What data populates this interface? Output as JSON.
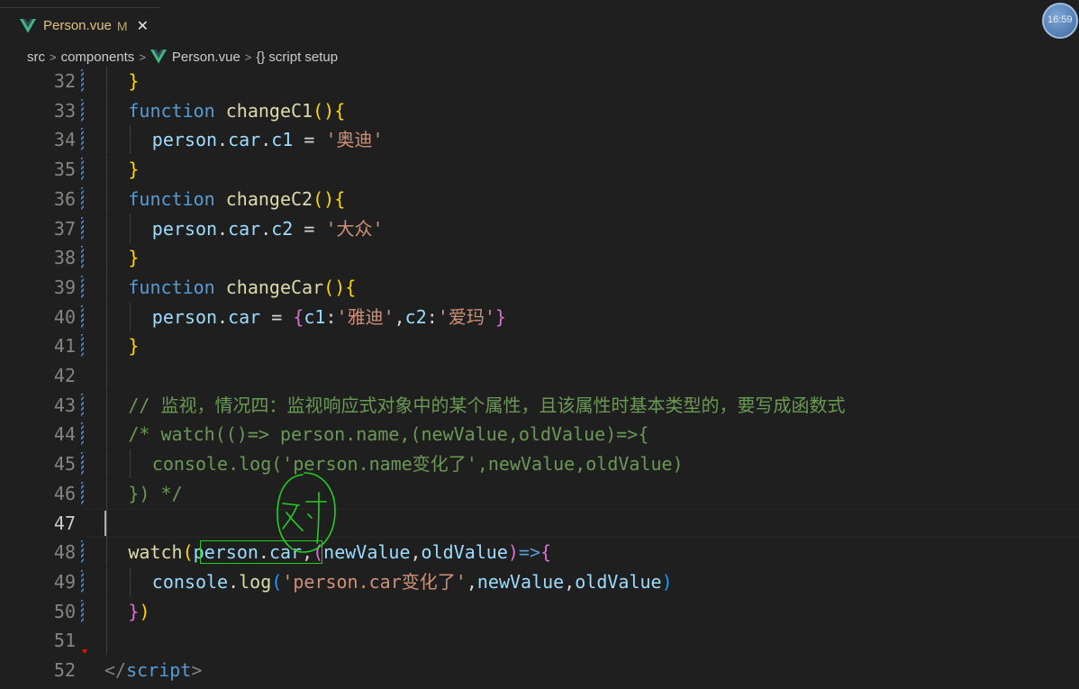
{
  "tab": {
    "label": "Person.vue",
    "modified": "M",
    "close": "✕"
  },
  "clock": {
    "time": "16:59"
  },
  "breadcrumb": {
    "src": "src",
    "components": "components",
    "file": "Person.vue",
    "braces": "{}",
    "section": "script setup"
  },
  "annotation": {
    "handwriting": "对"
  },
  "lines": [
    {
      "n": "32",
      "parts": [
        [
          "br1",
          "}"
        ]
      ]
    },
    {
      "n": "33",
      "parts": [
        [
          "kw",
          "function"
        ],
        [
          "op",
          " "
        ],
        [
          "fn",
          "changeC1"
        ],
        [
          "br1",
          "("
        ],
        [
          "br1",
          ")"
        ],
        [
          "br1",
          "{"
        ]
      ]
    },
    {
      "n": "34",
      "parts": [
        [
          "var",
          "person"
        ],
        [
          "op",
          "."
        ],
        [
          "var",
          "car"
        ],
        [
          "op",
          "."
        ],
        [
          "var",
          "c1"
        ],
        [
          "op",
          " = "
        ],
        [
          "str",
          "'奥迪'"
        ]
      ]
    },
    {
      "n": "35",
      "parts": [
        [
          "br1",
          "}"
        ]
      ]
    },
    {
      "n": "36",
      "parts": [
        [
          "kw",
          "function"
        ],
        [
          "op",
          " "
        ],
        [
          "fn",
          "changeC2"
        ],
        [
          "br1",
          "("
        ],
        [
          "br1",
          ")"
        ],
        [
          "br1",
          "{"
        ]
      ]
    },
    {
      "n": "37",
      "parts": [
        [
          "var",
          "person"
        ],
        [
          "op",
          "."
        ],
        [
          "var",
          "car"
        ],
        [
          "op",
          "."
        ],
        [
          "var",
          "c2"
        ],
        [
          "op",
          " = "
        ],
        [
          "str",
          "'大众'"
        ]
      ]
    },
    {
      "n": "38",
      "parts": [
        [
          "br1",
          "}"
        ]
      ]
    },
    {
      "n": "39",
      "parts": [
        [
          "kw",
          "function"
        ],
        [
          "op",
          " "
        ],
        [
          "fn",
          "changeCar"
        ],
        [
          "br1",
          "("
        ],
        [
          "br1",
          ")"
        ],
        [
          "br1",
          "{"
        ]
      ]
    },
    {
      "n": "40",
      "parts": [
        [
          "var",
          "person"
        ],
        [
          "op",
          "."
        ],
        [
          "var",
          "car"
        ],
        [
          "op",
          " = "
        ],
        [
          "br2",
          "{"
        ],
        [
          "var",
          "c1"
        ],
        [
          "op",
          ":"
        ],
        [
          "str",
          "'雅迪'"
        ],
        [
          "op",
          ","
        ],
        [
          "var",
          "c2"
        ],
        [
          "op",
          ":"
        ],
        [
          "str",
          "'爱玛'"
        ],
        [
          "br2",
          "}"
        ]
      ]
    },
    {
      "n": "41",
      "parts": [
        [
          "br1",
          "}"
        ]
      ]
    },
    {
      "n": "42",
      "parts": []
    },
    {
      "n": "43",
      "parts": [
        [
          "cm",
          "// 监视，情况四：监视响应式对象中的某个属性，且该属性时基本类型的，要写成函数式"
        ]
      ]
    },
    {
      "n": "44",
      "parts": [
        [
          "cm",
          "/* watch(()=> person.name,(newValue,oldValue)=>{"
        ]
      ]
    },
    {
      "n": "45",
      "parts": [
        [
          "cm",
          "console.log('person.name变化了',newValue,oldValue)"
        ]
      ]
    },
    {
      "n": "46",
      "parts": [
        [
          "cm",
          "}) */"
        ]
      ]
    },
    {
      "n": "47",
      "parts": []
    },
    {
      "n": "48",
      "parts": [
        [
          "fn",
          "watch"
        ],
        [
          "br1",
          "("
        ],
        [
          "var",
          "person"
        ],
        [
          "op",
          "."
        ],
        [
          "var",
          "car"
        ],
        [
          "op",
          ","
        ],
        [
          "br2",
          "("
        ],
        [
          "var",
          "newValue"
        ],
        [
          "op",
          ","
        ],
        [
          "var",
          "oldValue"
        ],
        [
          "br2",
          ")"
        ],
        [
          "kw",
          "=>"
        ],
        [
          "br2",
          "{"
        ]
      ]
    },
    {
      "n": "49",
      "parts": [
        [
          "var",
          "console"
        ],
        [
          "op",
          "."
        ],
        [
          "fn",
          "log"
        ],
        [
          "br3",
          "("
        ],
        [
          "str",
          "'person.car变化了'"
        ],
        [
          "op",
          ","
        ],
        [
          "var",
          "newValue"
        ],
        [
          "op",
          ","
        ],
        [
          "var",
          "oldValue"
        ],
        [
          "br3",
          ")"
        ]
      ]
    },
    {
      "n": "50",
      "parts": [
        [
          "br2",
          "}"
        ],
        [
          "br1",
          ")"
        ]
      ]
    },
    {
      "n": "51",
      "parts": []
    },
    {
      "n": "52",
      "parts": [
        [
          "tagb",
          "</"
        ],
        [
          "tag",
          "script"
        ],
        [
          "tagb",
          ">"
        ]
      ]
    }
  ],
  "colors": {
    "background": "#1f1f1f",
    "keyword": "#569cd6",
    "function": "#dcdcaa",
    "variable": "#9cdcfe",
    "string": "#ce9178",
    "comment": "#6a9955",
    "annotation": "#22d022"
  }
}
